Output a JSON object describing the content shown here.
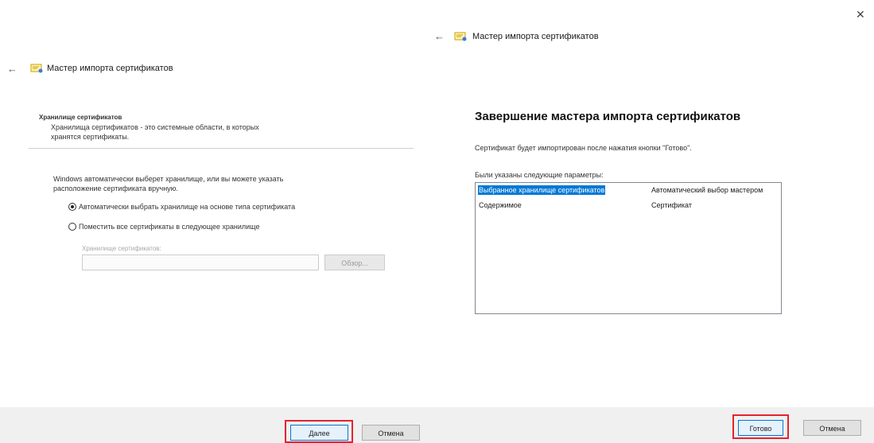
{
  "left": {
    "back_icon": "back-arrow-icon",
    "title": "Мастер импорта сертификатов",
    "section_title": "Хранилище сертификатов",
    "section_desc_line1": "Хранилища сертификатов - это системные области, в которых",
    "section_desc_line2": "хранятся сертификаты.",
    "intro_line1": "Windows автоматически выберет хранилище, или вы можете указать",
    "intro_line2": "расположение сертификата вручную.",
    "radio_auto_label": "Автоматически выбрать хранилище на основе типа сертификата",
    "radio_manual_label": "Поместить все сертификаты в следующее хранилище",
    "store_label": "Хранилище сертификатов:",
    "store_value": "",
    "browse_label": "Обзор...",
    "next_label": "Далее",
    "cancel_label": "Отмена"
  },
  "right": {
    "close_icon": "close-icon",
    "back_icon": "back-arrow-icon",
    "title": "Мастер импорта сертификатов",
    "heading": "Завершение мастера импорта сертификатов",
    "info_text": "Сертификат будет импортирован после нажатия кнопки \"Готово\".",
    "params_label": "Были указаны следующие параметры:",
    "params": [
      {
        "key": "Выбранное хранилище сертификатов",
        "value": "Автоматический выбор мастером"
      },
      {
        "key": "Содержимое",
        "value": "Сертификат"
      }
    ],
    "finish_label": "Готово",
    "cancel_label": "Отмена"
  },
  "colors": {
    "highlight": "#e5232e",
    "selection": "#0078d7"
  }
}
